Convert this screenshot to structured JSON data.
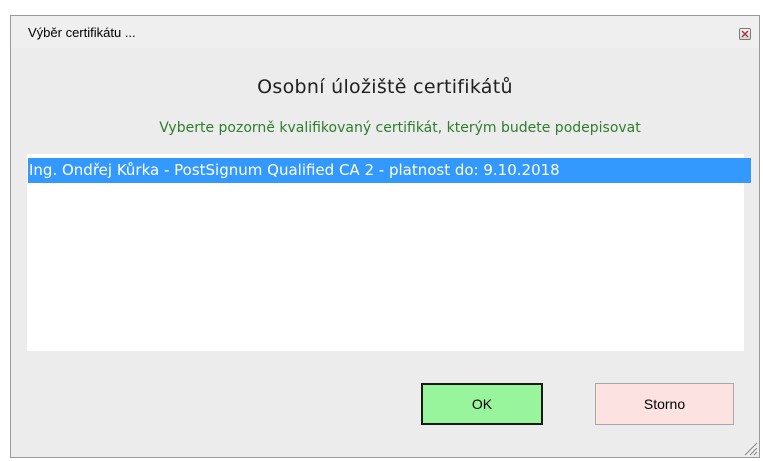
{
  "window": {
    "title": "Výběr certifikátu ..."
  },
  "dialog": {
    "heading": "Osobní úložiště certifikátů",
    "instruction": "Vyberte pozorně kvalifikovaný certifikát, kterým budete podepisovat"
  },
  "certificates": [
    {
      "label": "Ing. Ondřej Kůrka - PostSignum Qualified CA 2 - platnost do: 9.10.2018",
      "selected": true
    }
  ],
  "buttons": {
    "ok_label": "OK",
    "cancel_label": "Storno"
  },
  "colors": {
    "selection": "#3399ff",
    "instruction_text": "#2e7d2e",
    "ok_button": "#98f59b",
    "cancel_button": "#fde2e2"
  },
  "icons": {
    "close": "close-icon",
    "resize": "resize-grip-icon"
  }
}
